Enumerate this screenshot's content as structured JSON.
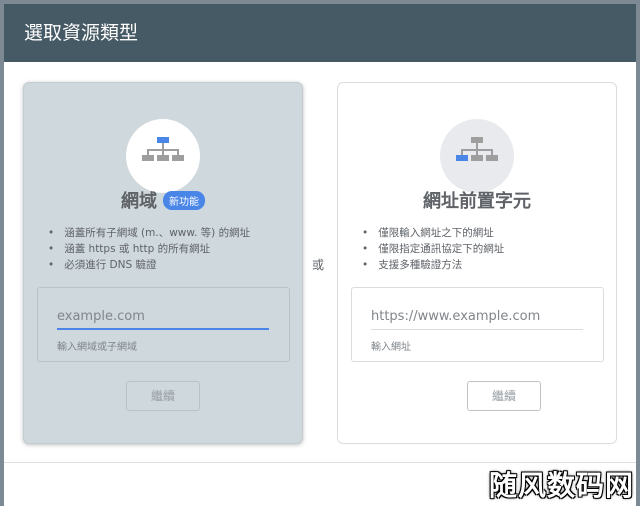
{
  "dialog": {
    "title": "選取資源類型"
  },
  "domain_card": {
    "title": "網域",
    "badge": "新功能",
    "bullets": [
      "涵蓋所有子網域 (m.、www. 等) 的網址",
      "涵蓋 https 或 http 的所有網址",
      "必須進行 DNS 驗證"
    ],
    "input_placeholder": "example.com",
    "input_value": "",
    "helper": "輸入網域或子網域",
    "continue_label": "繼續",
    "icon": "sitemap-icon"
  },
  "or_label": "或",
  "prefix_card": {
    "title": "網址前置字元",
    "bullets": [
      "僅限輸入網址之下的網址",
      "僅限指定通訊協定下的網址",
      "支援多種驗證方法"
    ],
    "input_placeholder": "https://www.example.com",
    "input_value": "",
    "helper": "輸入網址",
    "continue_label": "繼續",
    "icon": "sitemap-icon"
  },
  "watermark": "随风数码网",
  "colors": {
    "header": "#455a64",
    "accent": "#4a86e8",
    "selected_card": "#cfd8dc"
  }
}
